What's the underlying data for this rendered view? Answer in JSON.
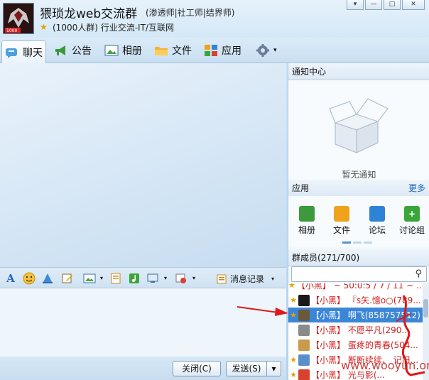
{
  "header": {
    "group_name": "猥琐龙web交流群",
    "tags": "(渗透师|社工师|结界师)",
    "description": "(1000人群) 行业交流-IT/互联网",
    "avatar_badge": "1000"
  },
  "toolbar": {
    "items": [
      {
        "label": "聊天",
        "icon": "chat-bubble-icon"
      },
      {
        "label": "公告",
        "icon": "megaphone-icon"
      },
      {
        "label": "相册",
        "icon": "photo-album-icon"
      },
      {
        "label": "文件",
        "icon": "folder-icon"
      },
      {
        "label": "应用",
        "icon": "apps-grid-icon"
      }
    ],
    "settings_icon": "gear-icon"
  },
  "input_toolbar": {
    "message_record": "消息记录"
  },
  "buttons": {
    "close": "关闭(C)",
    "send": "发送(S)"
  },
  "notice_center": {
    "title": "通知中心",
    "empty_text": "暂无通知"
  },
  "apps_panel": {
    "title": "应用",
    "more": "更多",
    "apps": [
      {
        "label": "相册",
        "color": "#3c9a3c"
      },
      {
        "label": "文件",
        "color": "#f0a21c"
      },
      {
        "label": "论坛",
        "color": "#2f83d6"
      },
      {
        "label": "讨论组",
        "color": "#3aa63a"
      }
    ]
  },
  "members": {
    "title": "群成员(271/700)",
    "list": [
      {
        "text": "【小黑】 ~ 50:0:5 / 7 / 11 ~ ...",
        "star": true
      },
      {
        "text": "【小黑】 『s矢.憶o○(789...",
        "star": true
      },
      {
        "text": "【小黑】 啊飞(858757512)",
        "star": true,
        "selected": true
      },
      {
        "text": "【小黑】 不愿平凡(290...",
        "star": false
      },
      {
        "text": "【小黑】 蛋疼的青春(504...",
        "star": false
      },
      {
        "text": "【小黑】 断断续续、 记旧...",
        "star": true
      },
      {
        "text": "【小黑】 光与影(...",
        "star": true
      }
    ]
  },
  "watermark": "www.wooyun.org"
}
